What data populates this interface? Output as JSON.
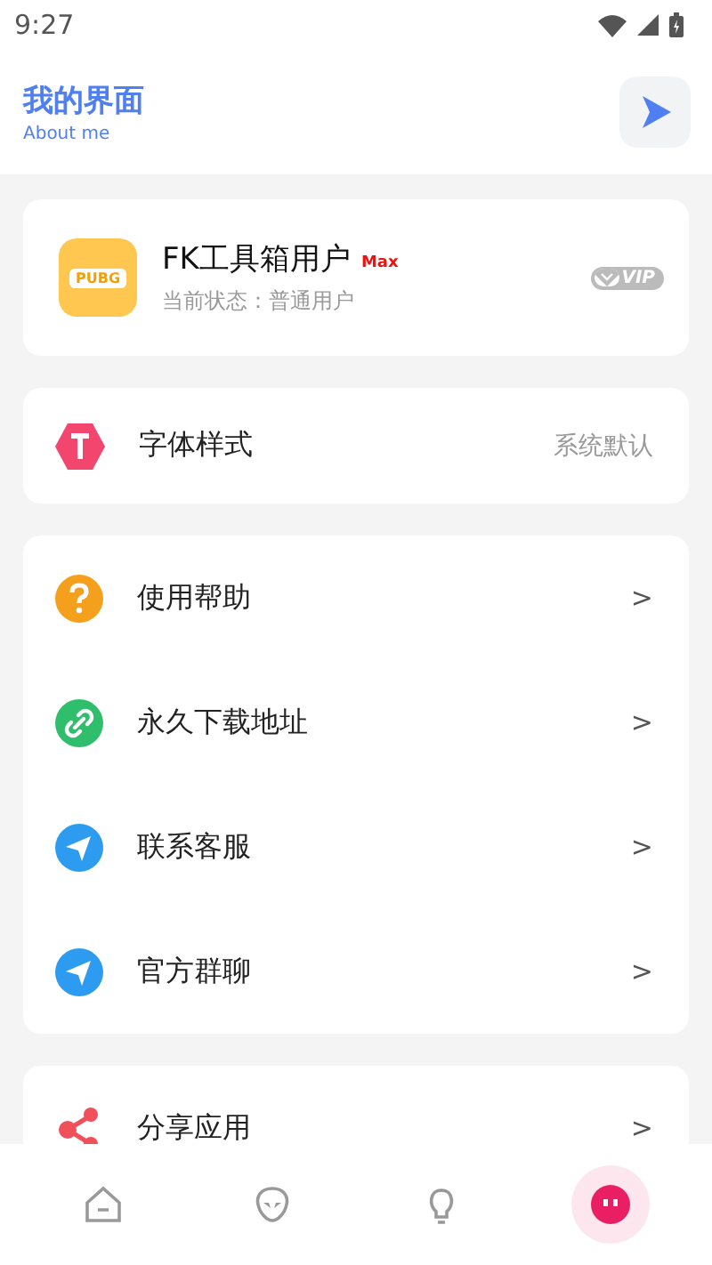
{
  "status_bar": {
    "time": "9:27"
  },
  "header": {
    "title": "我的界面",
    "subtitle": "About me"
  },
  "profile": {
    "avatar_label": "PUBG",
    "name": "FK工具箱用户",
    "tier": "Max",
    "status": "当前状态：普通用户",
    "badge": "VIP"
  },
  "sections": [
    {
      "items": [
        {
          "label": "字体样式",
          "kind": "value",
          "value": "系统默认"
        }
      ]
    },
    {
      "items": [
        {
          "label": "使用帮助",
          "kind": "chevron",
          "trail": ">"
        },
        {
          "label": "永久下载地址",
          "kind": "chevron",
          "trail": ">"
        },
        {
          "label": "联系客服",
          "kind": "chevron",
          "trail": ">"
        },
        {
          "label": "官方群聊",
          "kind": "chevron",
          "trail": ">"
        }
      ]
    },
    {
      "items": [
        {
          "label": "分享应用",
          "kind": "chevron",
          "trail": ">"
        }
      ]
    }
  ],
  "bottom_nav": [
    {
      "selected": false
    },
    {
      "selected": false
    },
    {
      "selected": false
    },
    {
      "selected": true
    }
  ]
}
